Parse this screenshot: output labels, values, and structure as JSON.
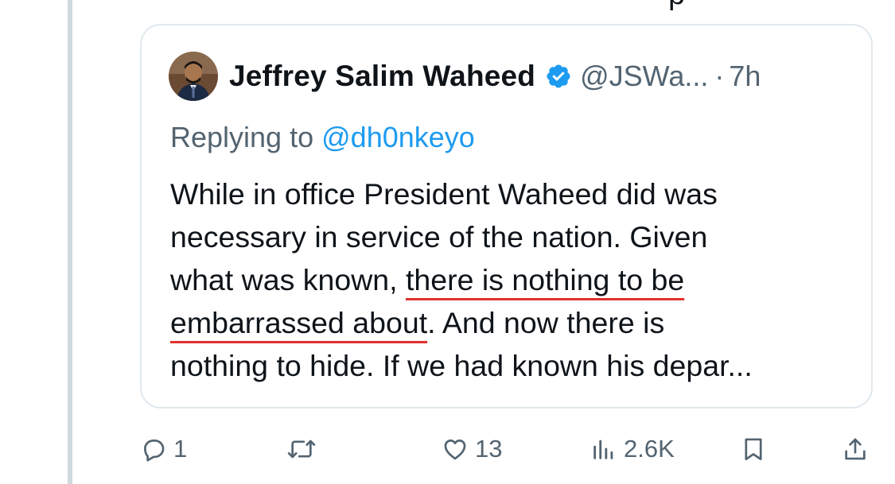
{
  "parent_tweet": {
    "cut_off_text": "p"
  },
  "quoted_tweet": {
    "author_name": "Jeffrey Salim Waheed",
    "handle": "@JSWa...",
    "separator": "·",
    "time": "7h",
    "replying_prefix": "Replying to",
    "replying_to": "@dh0nkeyo",
    "body": {
      "line1": "While in office President Waheed did was",
      "line2": "necessary in service of the nation. Given",
      "line3_prefix": "what was known, ",
      "line3_underlined": "there is nothing to be",
      "line4_underlined": "embarrassed about",
      "line4_suffix": ". And now there is",
      "line5": "nothing to hide. If we had known his depar..."
    }
  },
  "actions": {
    "reply_count": "1",
    "retweet_count": "",
    "like_count": "13",
    "views_count": "2.6K"
  },
  "colors": {
    "link": "#1d9bf0",
    "muted": "#536471",
    "underline": "#e0312e",
    "verified": "#1d9bf0"
  },
  "icons": [
    "reply-icon",
    "retweet-icon",
    "like-icon",
    "views-icon",
    "bookmark-icon",
    "share-icon",
    "verified-badge-icon"
  ]
}
